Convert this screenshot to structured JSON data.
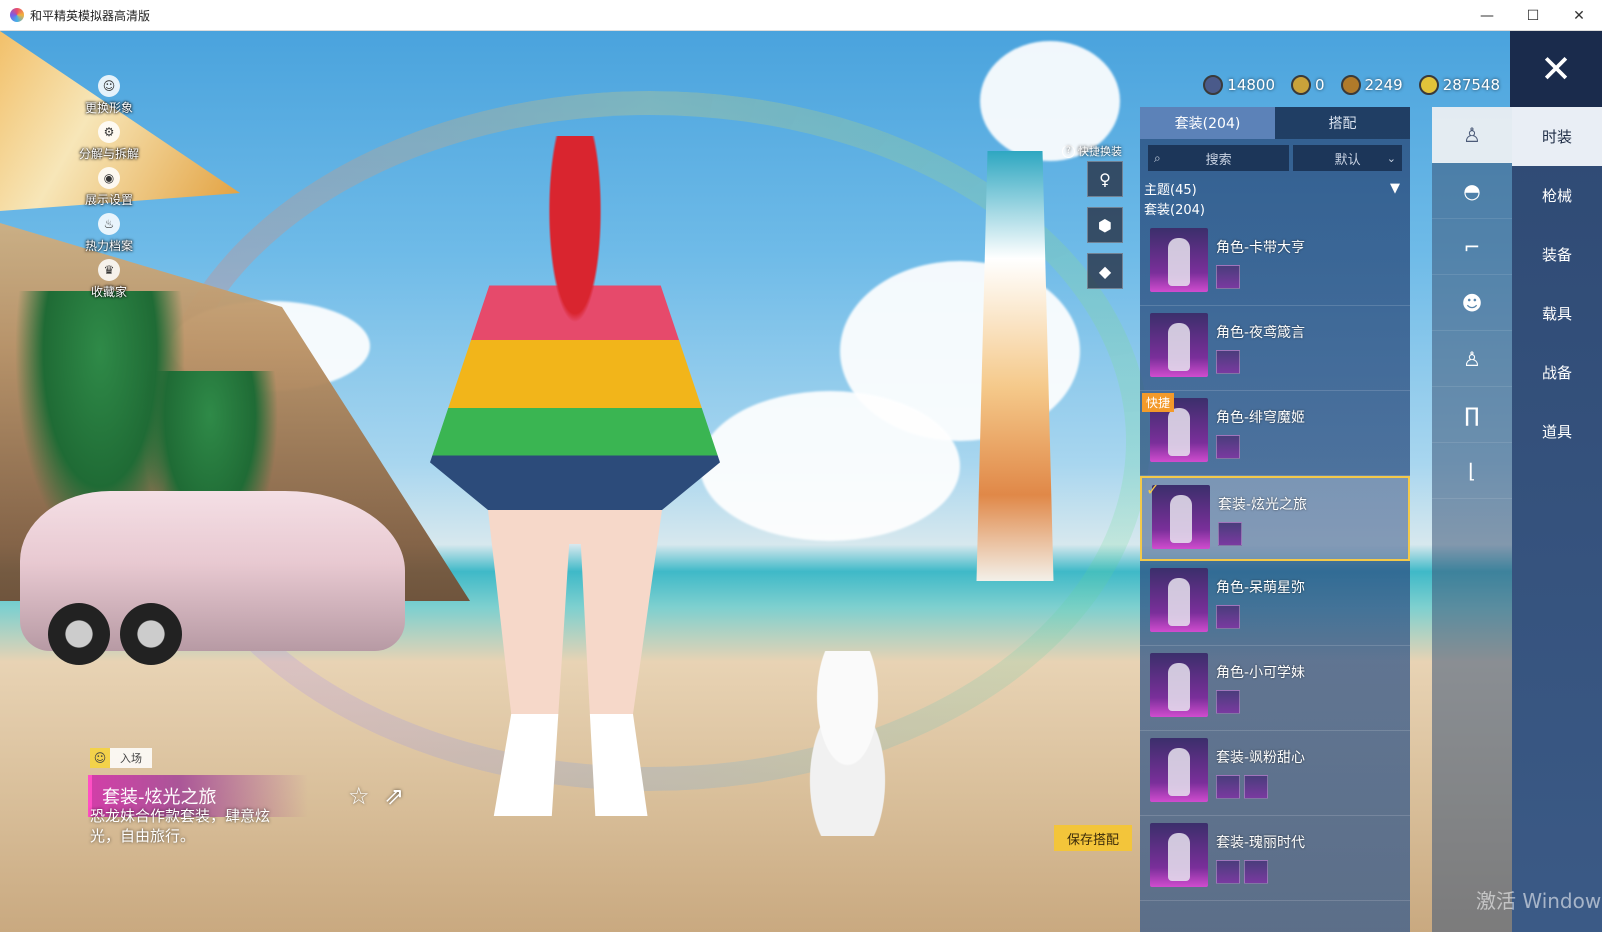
{
  "window": {
    "title": "和平精英模拟器高清版",
    "controls": [
      "—",
      "☐",
      "✕"
    ]
  },
  "side_menu": [
    {
      "label": "更换形象",
      "icon": "person-icon"
    },
    {
      "label": "分解与拆解",
      "icon": "gear-icon"
    },
    {
      "label": "展示设置",
      "icon": "eye-icon"
    },
    {
      "label": "热力档案",
      "icon": "flame-icon"
    },
    {
      "label": "收藏家",
      "icon": "crown-icon"
    }
  ],
  "currency": [
    {
      "value": "14800",
      "color": "#4a5a8a"
    },
    {
      "value": "0",
      "color": "#c9a23a"
    },
    {
      "value": "2249",
      "color": "#b07a2a"
    },
    {
      "value": "287548",
      "color": "#e2c33a"
    }
  ],
  "close_icon": "✕",
  "panel": {
    "tabs": [
      "套装(204)",
      "搭配"
    ],
    "search_label": "搜索",
    "sort_label": "默认",
    "theme_label": "主题(45)",
    "suit_label": "套装(204)",
    "items": [
      {
        "name": "角色-卡带大亨",
        "quick": "",
        "selected": false
      },
      {
        "name": "角色-夜鸢箴言",
        "quick": "",
        "selected": false
      },
      {
        "name": "角色-绯穹魔姬",
        "quick": "快捷",
        "selected": false
      },
      {
        "name": "套装-炫光之旅",
        "quick": "",
        "selected": true
      },
      {
        "name": "角色-呆萌星弥",
        "quick": "",
        "selected": false
      },
      {
        "name": "角色-小可学妹",
        "quick": "",
        "selected": false
      },
      {
        "name": "套装-飒粉甜心",
        "quick": "",
        "selected": false
      },
      {
        "name": "套装-瑰丽时代",
        "quick": "",
        "selected": false
      }
    ]
  },
  "quick_change": {
    "label": "快捷换装",
    "slots": [
      "figure-slot-icon",
      "badge-slot-icon",
      "diamond-slot-icon"
    ]
  },
  "right_tabs": [
    "时装",
    "枪械",
    "装备",
    "载具",
    "战备",
    "道具"
  ],
  "category_icons": [
    "outfit-icon",
    "cap-icon",
    "glasses-icon",
    "mask-icon",
    "suit-icon",
    "pants-icon",
    "shoes-icon"
  ],
  "selected_outfit": {
    "entry_label": "入场",
    "title": "套装-炫光之旅",
    "description": "恐龙妹合作款套装，肆意炫光，自由旅行。"
  },
  "save_button": "保存搭配",
  "watermark": "激活 Window"
}
